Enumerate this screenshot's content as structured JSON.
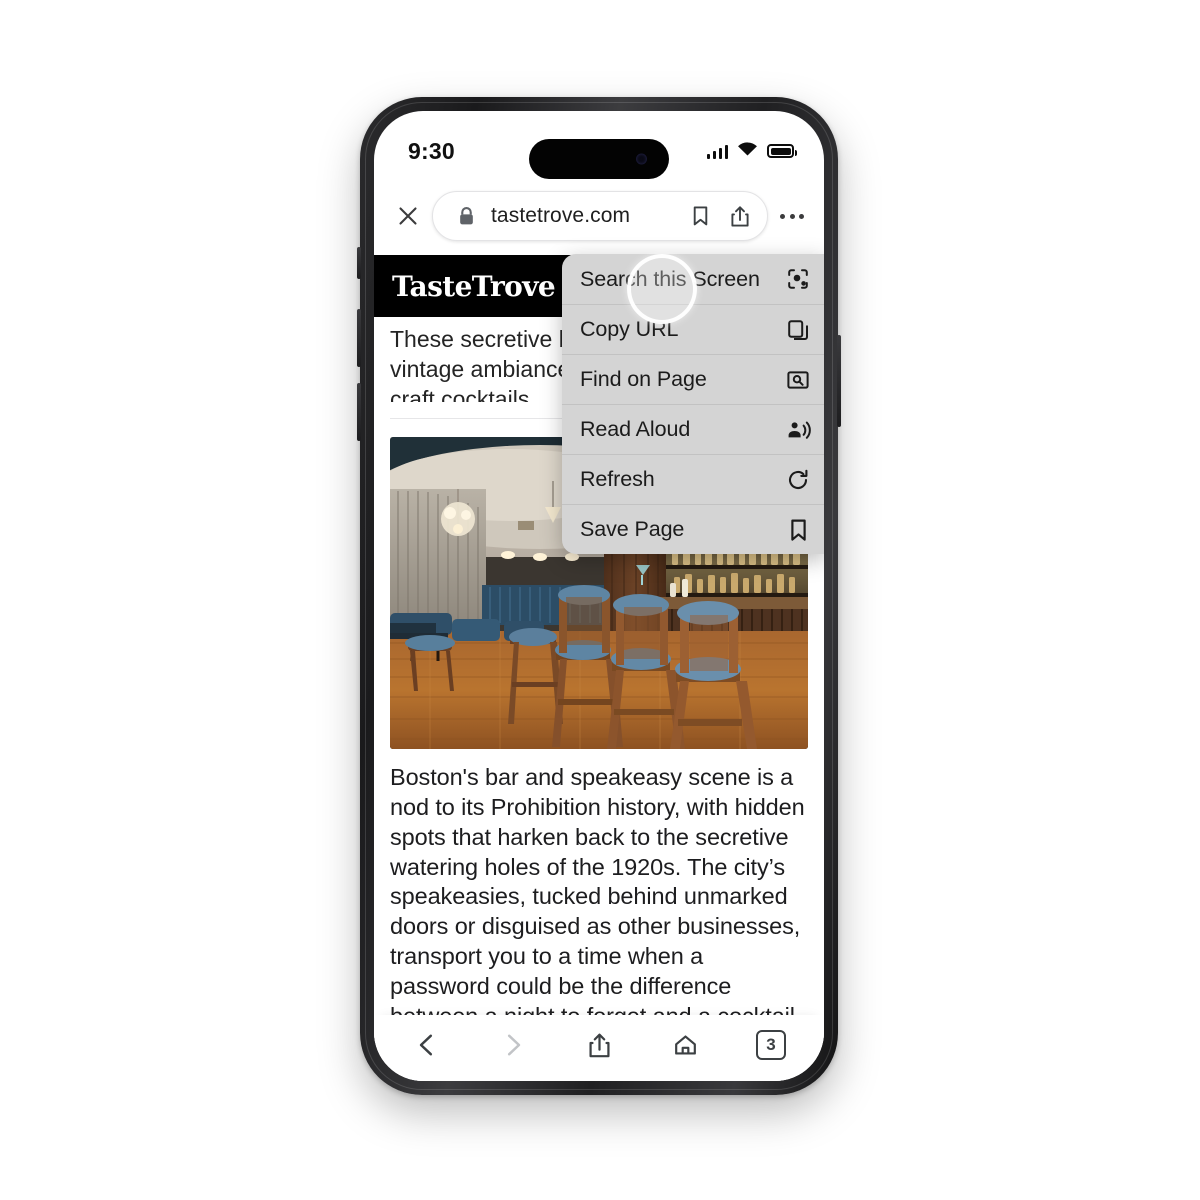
{
  "status_bar": {
    "time": "9:30",
    "signal_icon": "cellular-signal-icon",
    "wifi_icon": "wifi-icon",
    "battery_icon": "battery-icon"
  },
  "browser": {
    "close_icon": "close-icon",
    "lock_icon": "lock-icon",
    "url": "tastetrove.com",
    "bookmark_icon": "bookmark-icon",
    "share_icon": "share-icon",
    "overflow_icon": "three-dot-menu-icon"
  },
  "webpage": {
    "site_name": "TasteTrove",
    "lede": "These secretive bars offer a nostalgic, vintage ambiance with jazz music, and craft cocktails.",
    "hero_image_alt": "Speakeasy bar interior with wooden bar stools, blue velvet seats and a chandelier",
    "body": "Boston's bar and speakeasy scene is a nod to its Prohibition history, with hidden spots that harken back to the secretive watering holes of the 1920s. The city’s speakeasies, tucked behind unmarked doors or disguised as other businesses, transport you to a time when a password could be the difference between a night to forget and a cocktail to remember."
  },
  "overflow_menu": {
    "items": [
      {
        "label": "Search this Screen",
        "icon": "lens-search-icon"
      },
      {
        "label": "Copy URL",
        "icon": "copy-icon"
      },
      {
        "label": "Find on Page",
        "icon": "find-in-page-icon"
      },
      {
        "label": "Read Aloud",
        "icon": "read-aloud-icon"
      },
      {
        "label": "Refresh",
        "icon": "refresh-icon"
      },
      {
        "label": "Save Page",
        "icon": "bookmark-icon"
      }
    ],
    "highlighted_item": "Search this Screen",
    "background_color": "#d4d4d4"
  },
  "bottom_toolbar": {
    "back_icon": "back-arrow-icon",
    "forward_icon": "forward-arrow-icon",
    "share_icon": "share-icon",
    "home_icon": "home-icon",
    "tab_count": "3"
  }
}
